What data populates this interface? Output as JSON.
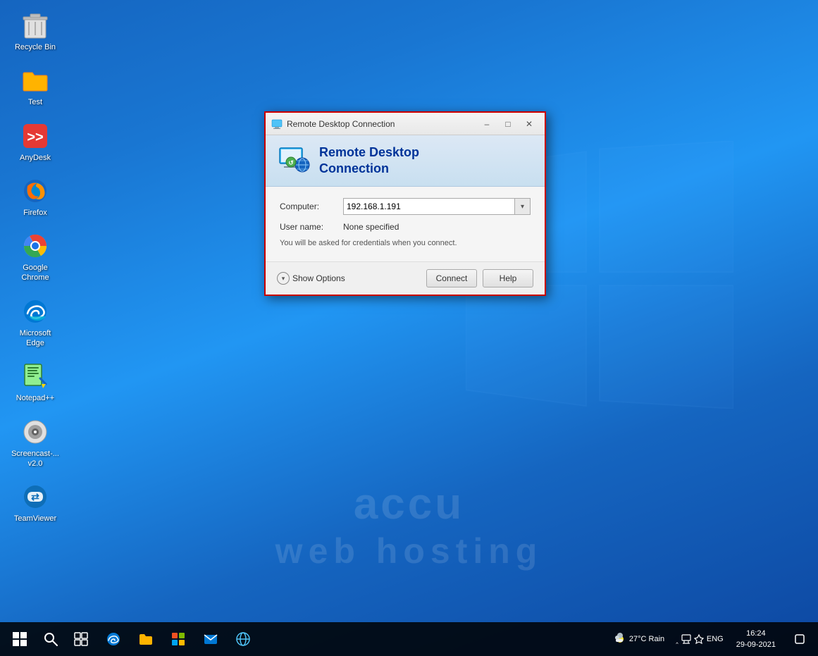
{
  "desktop": {
    "background_color1": "#1565c0",
    "background_color2": "#2196f3",
    "watermark_line1": "accu",
    "watermark_line2": "web hosting"
  },
  "icons": [
    {
      "id": "recycle-bin",
      "label": "Recycle Bin",
      "type": "recycle"
    },
    {
      "id": "test",
      "label": "Test",
      "type": "folder"
    },
    {
      "id": "anydesk",
      "label": "AnyDesk",
      "type": "anydesk"
    },
    {
      "id": "firefox",
      "label": "Firefox",
      "type": "firefox"
    },
    {
      "id": "google-chrome",
      "label": "Google Chrome",
      "type": "chrome"
    },
    {
      "id": "microsoft-edge",
      "label": "Microsoft Edge",
      "type": "edge"
    },
    {
      "id": "notepadpp",
      "label": "Notepad++",
      "type": "notepad"
    },
    {
      "id": "screencast",
      "label": "Screencast-...\nv2.0",
      "type": "screencast"
    },
    {
      "id": "teamviewer",
      "label": "TeamViewer",
      "type": "teamviewer"
    }
  ],
  "dialog": {
    "title": "Remote Desktop Connection",
    "header_line1": "Remote Desktop",
    "header_line2": "Connection",
    "computer_label": "Computer:",
    "computer_value": "192.168.1.191",
    "username_label": "User name:",
    "username_value": "None specified",
    "note": "You will be asked for credentials when you connect.",
    "show_options_label": "Show Options",
    "connect_label": "Connect",
    "help_label": "Help"
  },
  "taskbar": {
    "start_label": "Start",
    "search_label": "Search",
    "weather": "27°C Rain",
    "language": "ENG",
    "time": "16:24",
    "date": "29-09-2021",
    "items": [
      {
        "id": "task-view",
        "label": "Task View"
      },
      {
        "id": "edge",
        "label": "Microsoft Edge"
      },
      {
        "id": "file-explorer",
        "label": "File Explorer"
      },
      {
        "id": "store",
        "label": "Microsoft Store"
      },
      {
        "id": "mail",
        "label": "Mail"
      },
      {
        "id": "ie",
        "label": "Internet Explorer"
      }
    ]
  }
}
